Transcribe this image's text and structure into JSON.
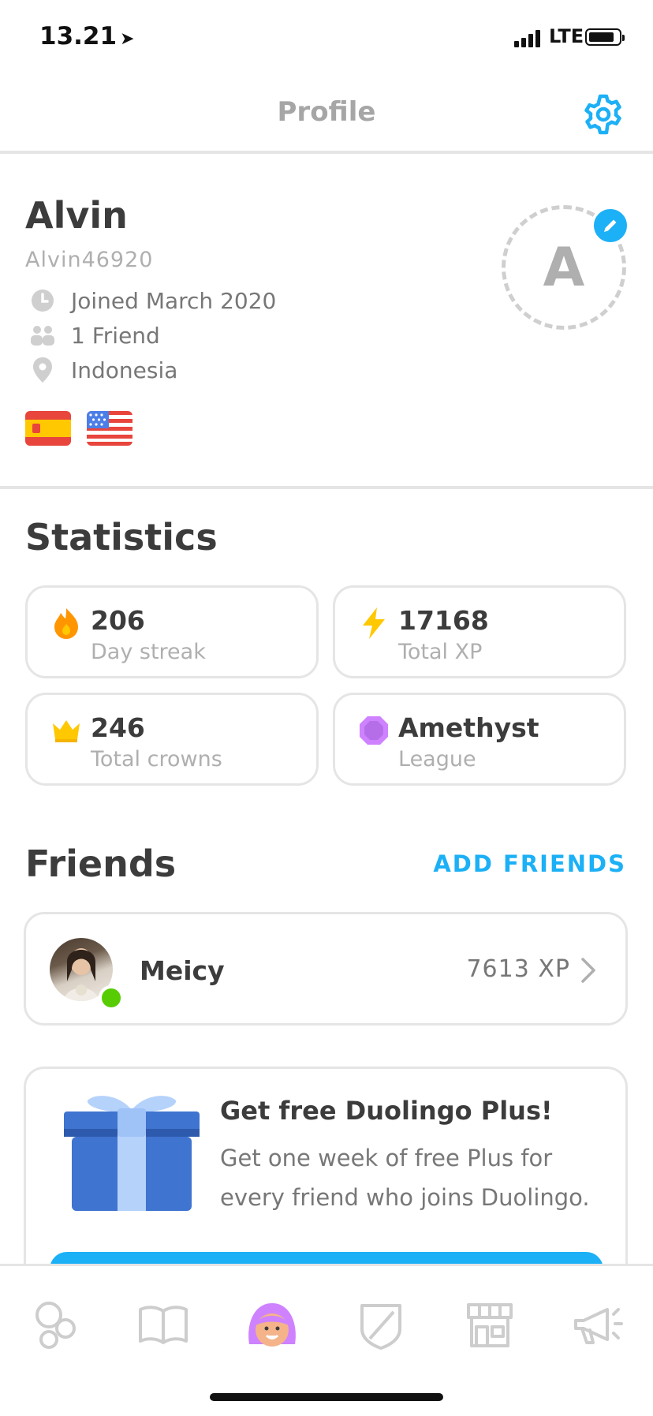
{
  "status_bar": {
    "time": "13.21",
    "network": "LTE"
  },
  "header": {
    "title": "Profile",
    "settings_icon": "gear-icon"
  },
  "profile": {
    "name": "Alvin",
    "username": "Alvin46920",
    "joined": "Joined March 2020",
    "friends": "1 Friend",
    "location": "Indonesia",
    "avatar_letter": "A",
    "languages": [
      "spain-flag",
      "usa-flag"
    ]
  },
  "statistics": {
    "title": "Statistics",
    "items": [
      {
        "value": "206",
        "label": "Day streak",
        "icon": "flame-icon",
        "color": "#ff9600"
      },
      {
        "value": "17168",
        "label": "Total XP",
        "icon": "lightning-icon",
        "color": "#ffc800"
      },
      {
        "value": "246",
        "label": "Total crowns",
        "icon": "crown-icon",
        "color": "#ffc800"
      },
      {
        "value": "Amethyst",
        "label": "League",
        "icon": "amethyst-icon",
        "color": "#ce82ff"
      }
    ]
  },
  "friends": {
    "title": "Friends",
    "add_label": "ADD FRIENDS",
    "list": [
      {
        "name": "Meicy",
        "xp": "7613 XP",
        "online": true
      }
    ]
  },
  "promo": {
    "title": "Get free Duolingo Plus!",
    "body": "Get one week of free Plus for every friend who joins Duolingo."
  },
  "tabs": [
    "learn-icon",
    "stories-icon",
    "profile-icon",
    "leaderboard-icon",
    "shop-icon",
    "news-icon"
  ],
  "colors": {
    "accent": "#1cb0f6",
    "border": "#e5e5e5",
    "online": "#58cc02"
  }
}
